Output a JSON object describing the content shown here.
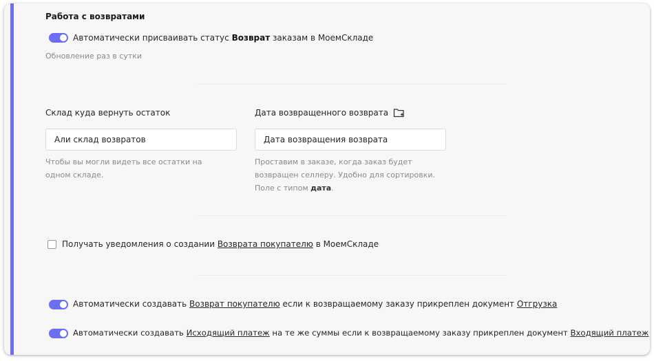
{
  "section": {
    "title": "Работа с возвратами"
  },
  "auto_status": {
    "prefix": "Автоматически присваивать статус ",
    "bold": "Возврат",
    "suffix": " заказам в МоемСкладе",
    "enabled": true,
    "hint": "Обновление раз в сутки"
  },
  "warehouse": {
    "label": "Склад куда вернуть остаток",
    "value": "Али склад возвратов",
    "hint": "Чтобы вы могли видеть все остатки на одном складе."
  },
  "return_date": {
    "label": "Дата возвращенного возврата",
    "icon": "folder-plus-icon",
    "value": "Дата возвращения возврата",
    "hint_main": "Проставим в заказе, когда заказ будет возвращен селлеру. Удобно для сортировки. Поле с типом ",
    "hint_bold": "дата",
    "hint_end": "."
  },
  "notify": {
    "checked": false,
    "prefix": "Получать уведомления о создании ",
    "link": "Возврата покупателю",
    "suffix": " в МоемСкладе"
  },
  "auto_create_return": {
    "enabled": true,
    "prefix": "Автоматически создавать ",
    "link1": "Возврат покупателю",
    "middle": " если к возвращаемому заказу прикреплен документ ",
    "link2": "Отгрузка"
  },
  "auto_create_payment": {
    "enabled": true,
    "prefix": "Автоматически создавать ",
    "link1": "Исходящий платеж",
    "middle": " на те же суммы если к возвращаемому заказу прикреплен документ ",
    "link2": "Входящий платеж"
  },
  "colors": {
    "accent": "#6b6ef0",
    "card_bg": "#f7f7f7",
    "hint": "#8a8a8a"
  }
}
